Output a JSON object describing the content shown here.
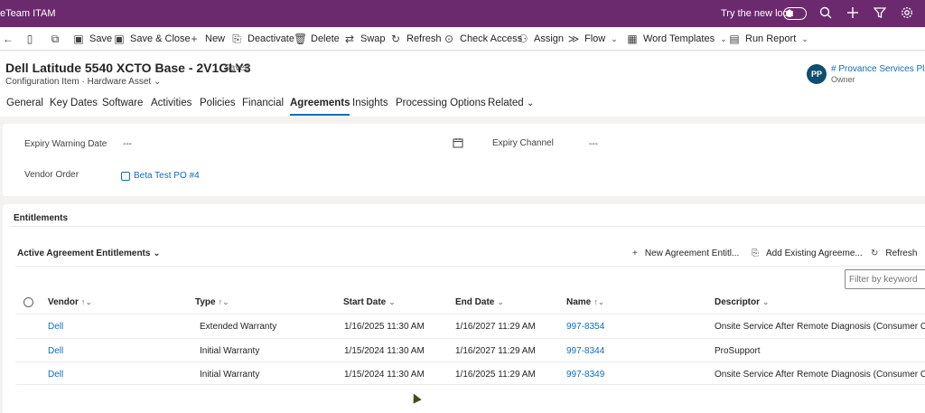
{
  "appbar": {
    "title": "eTeam ITAM",
    "try_new_look": "Try the new look",
    "icons": [
      "search-icon",
      "plus-icon",
      "filter-icon",
      "gear-icon"
    ]
  },
  "commands": [
    {
      "label": "",
      "icon": "back-icon"
    },
    {
      "label": "",
      "icon": "document-icon"
    },
    {
      "label": "",
      "icon": "open-window-icon"
    },
    {
      "label": "Save",
      "icon": "save-icon"
    },
    {
      "label": "Save & Close",
      "icon": "save-close-icon"
    },
    {
      "label": "New",
      "icon": "plus-icon"
    },
    {
      "label": "Deactivate",
      "icon": "deactivate-icon"
    },
    {
      "label": "Delete",
      "icon": "trash-icon"
    },
    {
      "label": "Swap",
      "icon": "swap-icon"
    },
    {
      "label": "Refresh",
      "icon": "refresh-icon"
    },
    {
      "label": "Check Access",
      "icon": "check-access-icon"
    },
    {
      "label": "Assign",
      "icon": "assign-icon"
    },
    {
      "label": "Flow",
      "icon": "flow-icon"
    },
    {
      "label": "Word Templates",
      "icon": "word-icon"
    },
    {
      "label": "Run Report",
      "icon": "report-icon"
    }
  ],
  "record": {
    "title": "Dell Latitude 5540 XCTO Base - 2V1GLY3",
    "saved": "- Saved",
    "entity": "Configuration Item",
    "type": "Hardware Asset",
    "owner_initials": "PP",
    "owner_name": "# Provance Services Platfo",
    "owner_label": "Owner"
  },
  "tabs": [
    "General",
    "Key Dates",
    "Software",
    "Activities",
    "Policies",
    "Financial",
    "Agreements",
    "Insights",
    "Processing Options",
    "Related"
  ],
  "active_tab": "Agreements",
  "fields": {
    "expiry_warning_label": "Expiry Warning Date",
    "expiry_warning_value": "---",
    "expiry_channel_label": "Expiry Channel",
    "expiry_channel_value": "---",
    "vendor_order_label": "Vendor Order",
    "vendor_order_value": "Beta Test PO #4"
  },
  "entitlements": {
    "section_title": "Entitlements",
    "view_name": "Active Agreement Entitlements",
    "new_label": "New Agreement Entitl...",
    "add_existing_label": "Add Existing Agreeme...",
    "refresh_label": "Refresh",
    "filter_placeholder": "Filter by keyword",
    "columns": [
      "Vendor",
      "Type",
      "Start Date",
      "End Date",
      "Name",
      "Descriptor"
    ],
    "rows": [
      {
        "vendor": "Dell",
        "type": "Extended Warranty",
        "start": "1/16/2025 11:30 AM",
        "end": "1/16/2027 11:29 AM",
        "name": "997-8354",
        "descriptor": "Onsite Service After Remote Diagnosis (Consumer Custo..."
      },
      {
        "vendor": "Dell",
        "type": "Initial Warranty",
        "start": "1/15/2024 11:30 AM",
        "end": "1/16/2027 11:29 AM",
        "name": "997-8344",
        "descriptor": "ProSupport"
      },
      {
        "vendor": "Dell",
        "type": "Initial Warranty",
        "start": "1/15/2024 11:30 AM",
        "end": "1/16/2025 11:29 AM",
        "name": "997-8349",
        "descriptor": "Onsite Service After Remote Diagnosis (Consumer Custo..."
      }
    ]
  }
}
